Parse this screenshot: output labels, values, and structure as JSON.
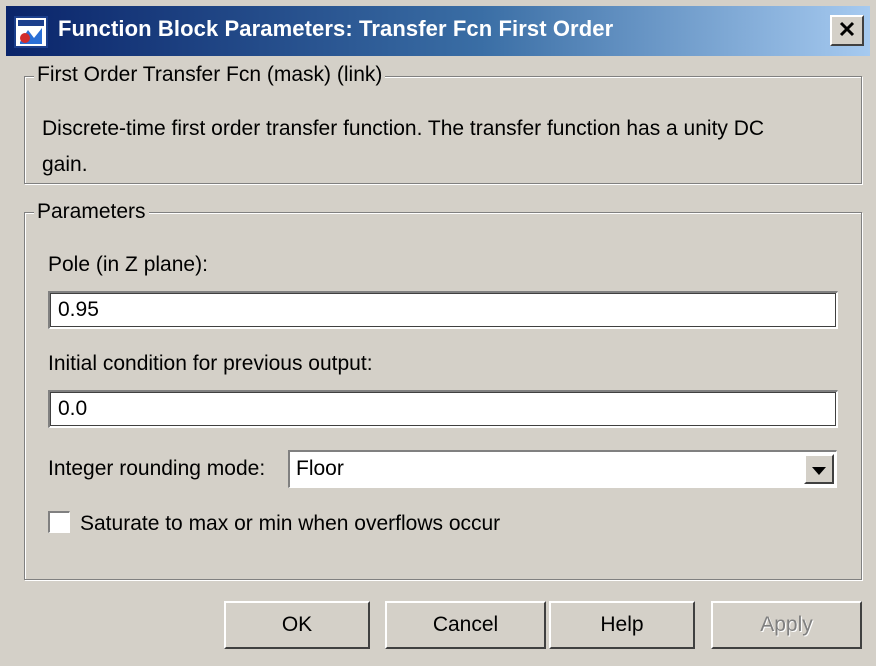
{
  "window": {
    "title": "Function Block Parameters: Transfer Fcn First Order",
    "icon": "simulink-block-icon",
    "close_icon": "close-icon"
  },
  "description_group": {
    "legend": "First Order Transfer Fcn (mask) (link)",
    "text": "Discrete-time first order transfer function.  The transfer function has a unity DC gain."
  },
  "parameters_group": {
    "legend": "Parameters",
    "pole_label": "Pole (in Z plane):",
    "pole_value": "0.95",
    "initial_label": "Initial condition for previous output:",
    "initial_value": "0.0",
    "rounding_label": "Integer rounding mode:",
    "rounding_value": "Floor",
    "saturate_label": "Saturate to max or min when overflows occur",
    "saturate_checked": false
  },
  "buttons": {
    "ok": "OK",
    "cancel": "Cancel",
    "help": "Help",
    "apply": "Apply"
  },
  "colors": {
    "window_bg": "#d4d0c8",
    "titlebar_start": "#0a246a",
    "titlebar_end": "#a6caf0"
  }
}
